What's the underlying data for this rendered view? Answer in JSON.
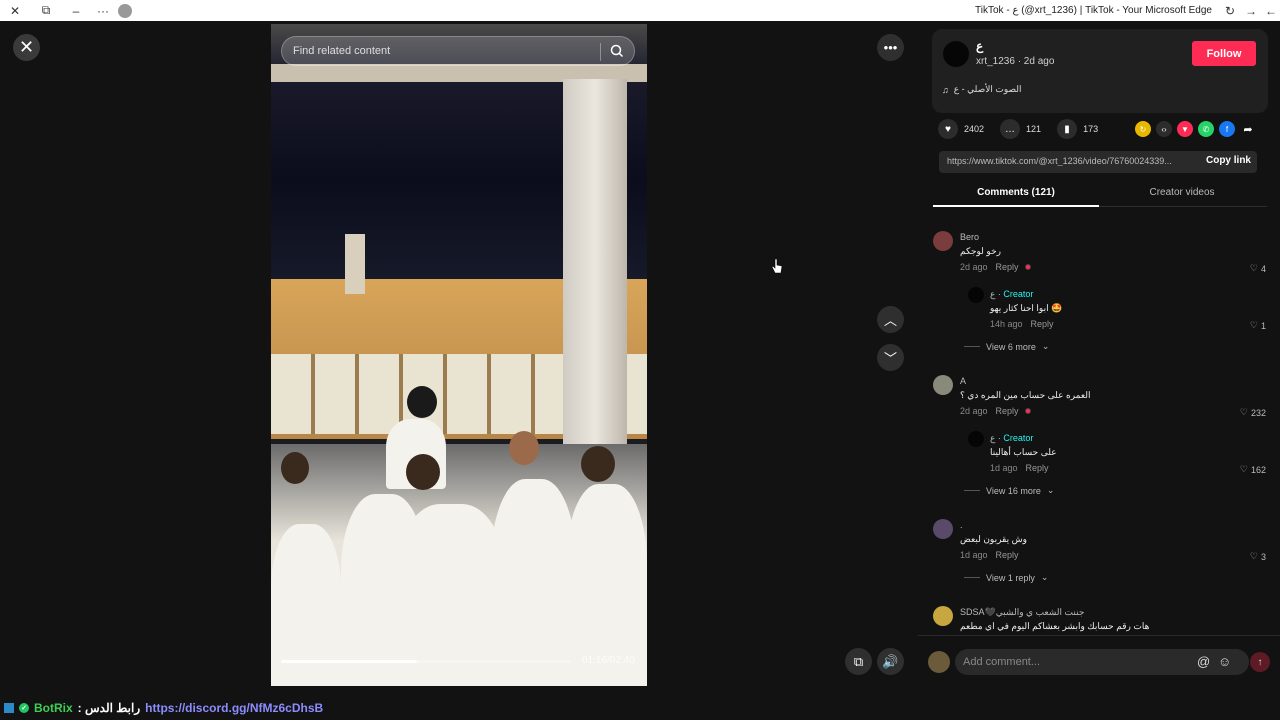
{
  "browser": {
    "title": "TikTok - ع (@xrt_1236) | TikTok - Your Microsoft Edge"
  },
  "video": {
    "search_placeholder": "Find related content",
    "progress": 0.47,
    "time": "01:16/02:40"
  },
  "author": {
    "name": "ع",
    "handle_line": "xrt_1236 · 2d ago",
    "follow_label": "Follow",
    "music": "الصوت الأصلي - ع"
  },
  "stats": {
    "likes": "2402",
    "comments": "121",
    "saves": "173"
  },
  "share": {
    "link": "https://www.tiktok.com/@xrt_1236/video/76760024339...",
    "copy_label": "Copy link"
  },
  "tabs": {
    "comments": "Comments (121)",
    "creator_videos": "Creator videos"
  },
  "comments": [
    {
      "name": "Bero",
      "text": "رخو لوجكم",
      "meta": "2d ago",
      "reply_label": "Reply",
      "likes": "4",
      "reply": {
        "name": "ع · ",
        "creator": "Creator",
        "text": "ابوا احنا كثار يهو 🤩",
        "meta": "14h ago",
        "reply_label": "Reply",
        "likes": "1"
      },
      "view_more": "View 6 more"
    },
    {
      "name": "A",
      "text": "العمره على حساب مين المره دي ؟",
      "meta": "2d ago",
      "reply_label": "Reply",
      "likes": "232",
      "reply": {
        "name": "ع · ",
        "creator": "Creator",
        "text": "على حساب أهالينا",
        "meta": "1d ago",
        "reply_label": "Reply",
        "likes": "162"
      },
      "view_more": "View 16 more"
    },
    {
      "name": ".",
      "text": "وش يقربون لبعض",
      "meta": "1d ago",
      "reply_label": "Reply",
      "likes": "3",
      "view_more": "View 1 reply"
    },
    {
      "name": "SDSA🖤جننت الشعب ي والشبي",
      "text": "هات رقم حسابك وابشر بعشاكم اليوم في اي مطعم"
    }
  ],
  "comment_box": {
    "placeholder": "Add comment..."
  },
  "overlay": {
    "bot_name": "BotRix",
    "bot_label": ": رابط الدس",
    "bot_link": "https://discord.gg/NfMz6cDhsB"
  },
  "colors": {
    "accent": "#fe2c55",
    "creator": "#25f4ee",
    "bot_green": "#3ccf53",
    "bot_link": "#8c8cff"
  }
}
